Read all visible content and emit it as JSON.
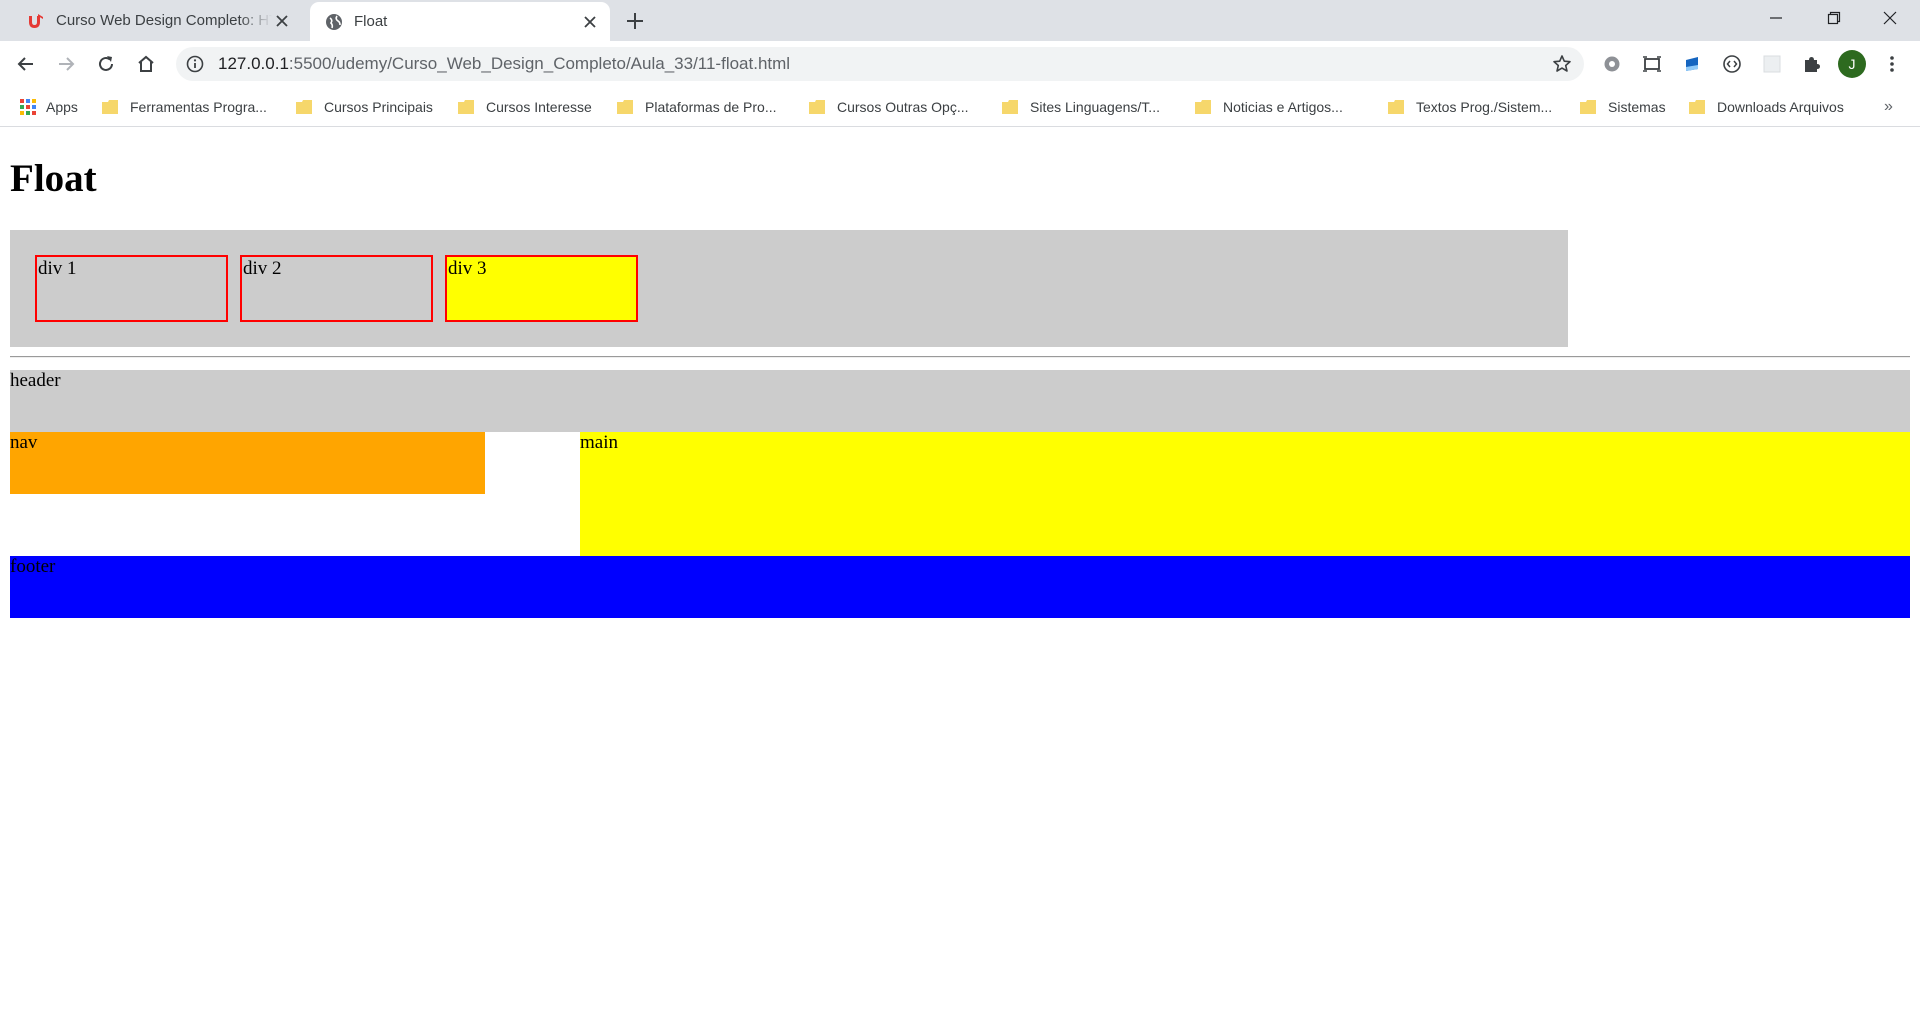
{
  "browser": {
    "tabs": [
      {
        "title": "Curso Web Design Completo: HT",
        "active": false,
        "icon": "udemy-icon"
      },
      {
        "title": "Float",
        "active": true,
        "icon": "globe-icon"
      }
    ],
    "url_host": "127.0.0.1",
    "url_path": ":5500/udemy/Curso_Web_Design_Completo/Aula_33/11-float.html",
    "avatar_letter": "J",
    "bookmarks": [
      {
        "label": "Apps",
        "icon": "apps-grid-icon"
      },
      {
        "label": "Ferramentas Progra...",
        "icon": "folder-icon"
      },
      {
        "label": "Cursos Principais",
        "icon": "folder-icon"
      },
      {
        "label": "Cursos Interesse",
        "icon": "folder-icon"
      },
      {
        "label": "Plataformas de Pro...",
        "icon": "folder-icon"
      },
      {
        "label": "Cursos Outras Opç...",
        "icon": "folder-icon"
      },
      {
        "label": "Sites Linguagens/T...",
        "icon": "folder-icon"
      },
      {
        "label": "Noticias e Artigos...",
        "icon": "folder-icon"
      },
      {
        "label": "Textos Prog./Sistem...",
        "icon": "folder-icon"
      },
      {
        "label": "Sistemas",
        "icon": "folder-icon"
      },
      {
        "label": "Downloads Arquivos",
        "icon": "folder-icon"
      }
    ],
    "bookmarks_overflow": "»"
  },
  "page": {
    "heading": "Float",
    "float_boxes": [
      {
        "label": "div 1",
        "bg": "#cccccc"
      },
      {
        "label": "div 2",
        "bg": "#cccccc"
      },
      {
        "label": "div 3",
        "bg": "#ffff00"
      }
    ],
    "layout": {
      "header": {
        "label": "header",
        "bg": "#cccccc"
      },
      "nav": {
        "label": "nav",
        "bg": "#ffa500"
      },
      "main": {
        "label": "main",
        "bg": "#ffff00"
      },
      "footer": {
        "label": "footer",
        "bg": "#0000ff"
      }
    }
  },
  "colors": {
    "tabstrip": "#dee1e6",
    "box_border": "#ff0000",
    "folder": "#f6d76b"
  }
}
